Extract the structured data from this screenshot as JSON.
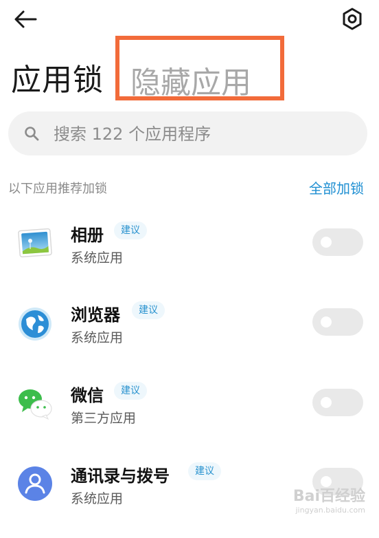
{
  "header": {
    "title": "应用锁",
    "tab_hidden_label": "隐藏应用",
    "back_icon": "arrow-left-icon",
    "settings_icon": "gear-icon"
  },
  "search": {
    "placeholder": "搜索 122 个应用程序",
    "value": ""
  },
  "section": {
    "label": "以下应用推荐加锁",
    "action_label": "全部加锁"
  },
  "apps": [
    {
      "name": "相册",
      "badge": "建议",
      "type": "系统应用",
      "icon": "gallery-icon",
      "locked": false
    },
    {
      "name": "浏览器",
      "badge": "建议",
      "type": "系统应用",
      "icon": "browser-globe-icon",
      "locked": false
    },
    {
      "name": "微信",
      "badge": "建议",
      "type": "第三方应用",
      "icon": "wechat-icon",
      "locked": false
    },
    {
      "name": "通讯录与拨号",
      "badge": "建议",
      "type": "系统应用",
      "icon": "contacts-icon",
      "locked": false
    }
  ],
  "watermark": {
    "brand": "Bai百经验",
    "url": "jingyan.baidu.com"
  },
  "colors": {
    "highlight_box": "#f26b3a",
    "accent": "#1f8fd2",
    "toggle_off": "#e9e9e9"
  }
}
